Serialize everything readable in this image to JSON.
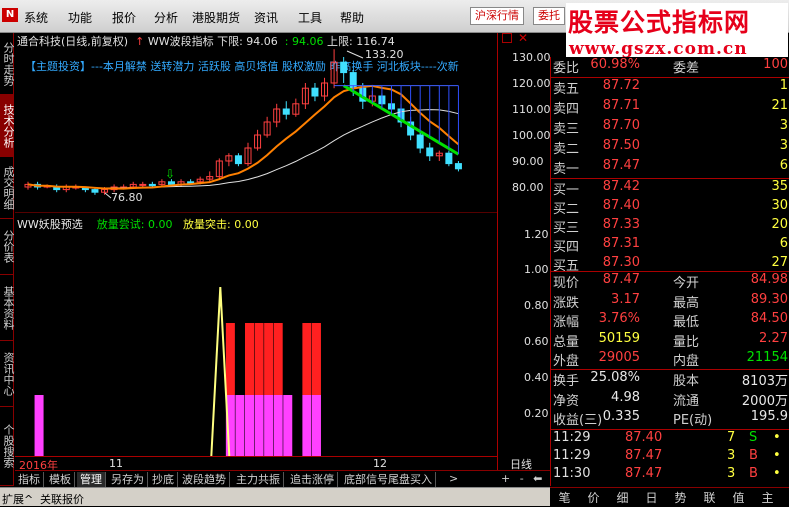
{
  "menubar": {
    "logo_text": "N",
    "items": [
      "系统",
      "功能",
      "报价",
      "分析",
      "港股期货",
      "资讯",
      "工具",
      "帮助"
    ],
    "btn_hk": "沪深行情",
    "btn_wt": "委托"
  },
  "watermark": {
    "title": "股票公式指标网",
    "url": "www.gszx.com.cn"
  },
  "left_tabs": [
    "分时走势",
    "技术分析",
    "成交明细",
    "分价表",
    "基本资料",
    "资讯中心",
    "个股搜索"
  ],
  "chart": {
    "stock": "通合科技(日线,前复权)",
    "indicator": "WW波段指标",
    "lower_label": "下限:",
    "lower_value": "94.06",
    "mid_value": "94.06",
    "upper_label": "上限:",
    "upper_value": "116.74",
    "news": "【主题投资】---本月解禁 送转潜力 活跃股 高贝塔值 股权激励 昨高换手 河北板块----次新",
    "high_annot": "133.20",
    "low_annot": "76.80",
    "price_axis": [
      "130.00",
      "120.00",
      "110.00",
      "100.00",
      "90.00",
      "80.00"
    ],
    "ind_name": "WW妖股预选",
    "ind_a_label": "放量尝试:",
    "ind_a_value": "0.00",
    "ind_b_label": "放量突击:",
    "ind_b_value": "0.00",
    "ind_axis": [
      "1.20",
      "1.00",
      "0.80",
      "0.60",
      "0.40",
      "0.20"
    ],
    "date_left": "2016年",
    "date_mid": "11",
    "date_right": "12",
    "period": "日线",
    "ctrl": "+ - ⬅ ➡"
  },
  "bottom_tabs": [
    "指标",
    "模板",
    "管理",
    "另存为",
    "抄底",
    "波段趋势",
    "主力共振",
    "追击涨停",
    "底部信号尾盘买入"
  ],
  "quote": {
    "wb_label": "委比",
    "wb_value": "60.98%",
    "wc_label": "委差",
    "wc_value": "100",
    "sells": [
      {
        "label": "卖五",
        "price": "87.72",
        "vol": "1"
      },
      {
        "label": "卖四",
        "price": "87.71",
        "vol": "21"
      },
      {
        "label": "卖三",
        "price": "87.70",
        "vol": "3"
      },
      {
        "label": "卖二",
        "price": "87.50",
        "vol": "3"
      },
      {
        "label": "卖一",
        "price": "87.47",
        "vol": "6"
      }
    ],
    "buys": [
      {
        "label": "买一",
        "price": "87.42",
        "vol": "35"
      },
      {
        "label": "买二",
        "price": "87.40",
        "vol": "30"
      },
      {
        "label": "买三",
        "price": "87.33",
        "vol": "20"
      },
      {
        "label": "买四",
        "price": "87.31",
        "vol": "6"
      },
      {
        "label": "买五",
        "price": "87.30",
        "vol": "27"
      }
    ],
    "stats": [
      {
        "l1": "现价",
        "v1": "87.47",
        "l2": "今开",
        "v2": "84.98"
      },
      {
        "l1": "涨跌",
        "v1": "3.17",
        "l2": "最高",
        "v2": "89.30"
      },
      {
        "l1": "涨幅",
        "v1": "3.76%",
        "l2": "最低",
        "v2": "84.50"
      },
      {
        "l1": "总量",
        "v1": "50159",
        "l2": "量比",
        "v2": "2.27"
      },
      {
        "l1": "外盘",
        "v1": "29005",
        "l2": "内盘",
        "v2": "21154"
      }
    ],
    "stats2": [
      {
        "l1": "换手",
        "v1": "25.08%",
        "l2": "股本",
        "v2": "8103万"
      },
      {
        "l1": "净资",
        "v1": "4.98",
        "l2": "流通",
        "v2": "2000万"
      },
      {
        "l1": "收益(三)",
        "v1": "0.335",
        "l2": "PE(动)",
        "v2": "195.9"
      }
    ],
    "ticks": [
      {
        "time": "11:29",
        "price": "87.40",
        "vol": "7",
        "flag": "S"
      },
      {
        "time": "11:29",
        "price": "87.47",
        "vol": "3",
        "flag": "B"
      },
      {
        "time": "11:30",
        "price": "87.47",
        "vol": "3",
        "flag": "B"
      }
    ]
  },
  "right_bottom_tabs": [
    "笔",
    "价",
    "细",
    "日",
    "势",
    "联",
    "值",
    "主"
  ],
  "statusbar": {
    "left": "扩展^",
    "right": "关联报价"
  },
  "colors": {
    "up": "#ff4040",
    "down": "#00e000",
    "magenta": "#ff40ff",
    "axis": "#aa0000"
  }
}
